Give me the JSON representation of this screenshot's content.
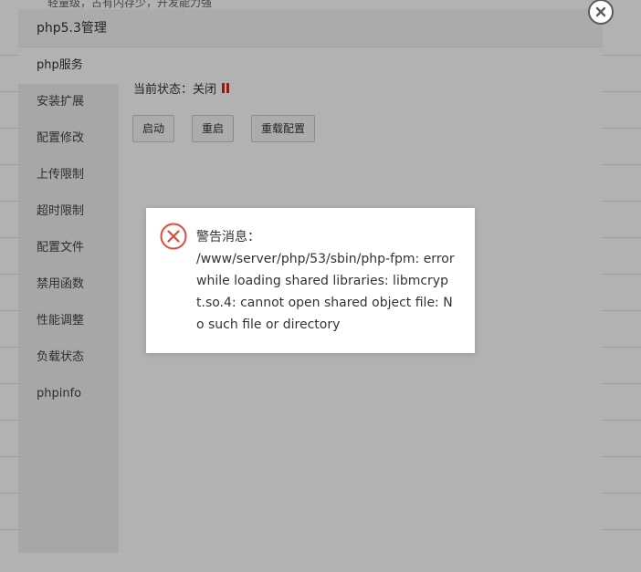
{
  "background": {
    "partial_text": "轻量级，占有内存少，开发能力强"
  },
  "dialog": {
    "title": "php5.3管理",
    "close_icon": "close-icon"
  },
  "sidebar": {
    "items": [
      {
        "label": "php服务"
      },
      {
        "label": "安装扩展"
      },
      {
        "label": "配置修改"
      },
      {
        "label": "上传限制"
      },
      {
        "label": "超时限制"
      },
      {
        "label": "配置文件"
      },
      {
        "label": "禁用函数"
      },
      {
        "label": "性能调整"
      },
      {
        "label": "负载状态"
      },
      {
        "label": "phpinfo"
      }
    ]
  },
  "service": {
    "status_label": "当前状态：",
    "status_value": "关闭",
    "status_icon": "pause-icon",
    "status_color": "#e02020",
    "buttons": {
      "start": "启动",
      "restart": "重启",
      "reload": "重载配置"
    }
  },
  "alert": {
    "icon": "error-circle-icon",
    "icon_color": "#e0493b",
    "title": "警告消息：",
    "message": "/www/server/php/53/sbin/php-fpm: error while loading shared libraries: libmcrypt.so.4: cannot open shared object file: No such file or directory"
  }
}
